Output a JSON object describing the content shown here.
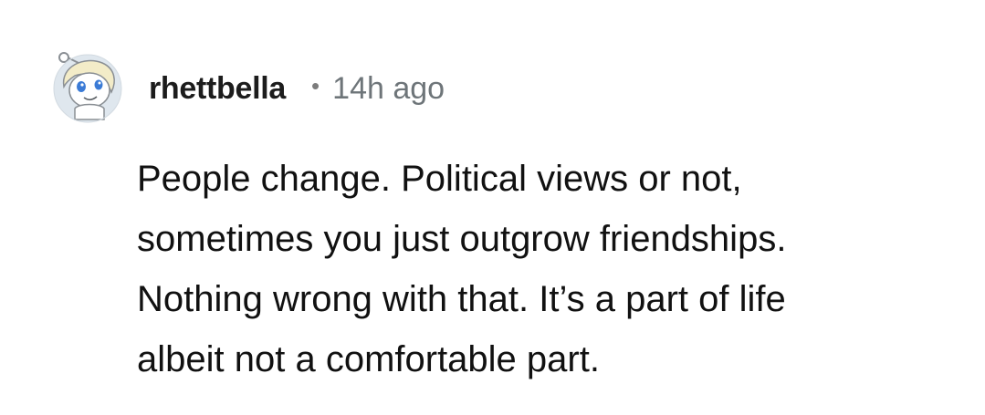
{
  "comment": {
    "avatar_icon": "snoo-avatar-icon",
    "username": "rhettbella",
    "separator": "•",
    "timestamp": "14h ago",
    "body_lines": [
      "People change. Political views or not,",
      "sometimes you just outgrow friendships.",
      "Nothing wrong with that. It’s a part of life",
      "albeit not a comfortable part."
    ]
  },
  "colors": {
    "username": "#1c1c1c",
    "timestamp": "#6e7579",
    "body": "#111111",
    "avatar_bg": "#dfe7ee"
  }
}
